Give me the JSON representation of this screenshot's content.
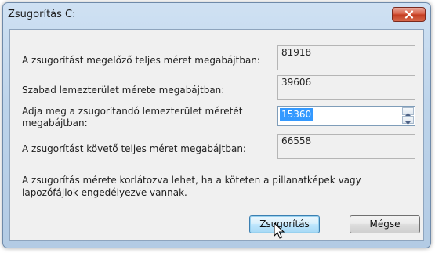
{
  "dialog": {
    "title": "Zsugorítás C:",
    "close_icon": "close-icon"
  },
  "fields": {
    "total_before_label": "A zsugorítást megelőző teljes méret megabájtban:",
    "total_before_value": "81918",
    "free_space_label": "Szabad lemezterület mérete megabájtban:",
    "free_space_value": "39606",
    "shrink_amount_label_line1": "Adja meg a zsugorítandó lemezterület méretét",
    "shrink_amount_label_line2": "megabájtban:",
    "shrink_amount_value": "15360",
    "total_after_label": "A zsugorítást követő teljes méret megabájtban:",
    "total_after_value": "66558"
  },
  "note": {
    "line1": "A zsugorítás mérete korlátozva lehet, ha a köteten a pillanatképek vagy",
    "line2": "lapozófájlok engedélyezve vannak."
  },
  "buttons": {
    "shrink_label": "Zsugorítás",
    "cancel_label": "Mégse"
  },
  "colors": {
    "close_button": "#c94a2f",
    "selection": "#3399ff",
    "default_button_border": "#3c7fb1"
  }
}
